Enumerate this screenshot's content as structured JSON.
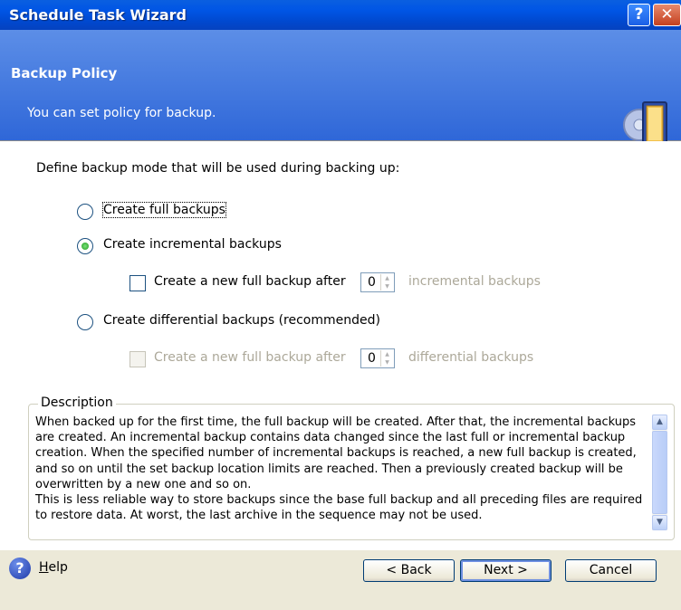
{
  "window": {
    "title": "Schedule Task Wizard",
    "help_glyph": "?",
    "close_glyph": "✕"
  },
  "header": {
    "title": "Backup Policy",
    "subtitle": "You can set policy for backup.",
    "icon": "wizard-book-icon"
  },
  "main": {
    "define_label": "Define backup mode that will be used during backing up:",
    "options": {
      "full": {
        "label": "Create full backups",
        "selected": false
      },
      "incremental": {
        "label": "Create incremental backups",
        "selected": true,
        "sub_check_label": "Create a new full backup after",
        "sub_value": "0",
        "sub_suffix": "incremental backups"
      },
      "differential": {
        "label": "Create differential backups (recommended)",
        "selected": false,
        "sub_check_label": "Create a new full backup after",
        "sub_value": "0",
        "sub_suffix": "differential backups"
      }
    },
    "description": {
      "legend": "Description",
      "text": "When backed up for the first time, the full backup will be created. After that, the incremental backups are created. An incremental backup contains data changed since the last full or incremental backup creation. When the specified number of incremental backups is reached, a new full backup is created, and so on until the set backup location limits are reached. Then a previously created backup will be overwritten by a new one and so on.\nThis is less reliable way to store backups since the base full backup and all preceding files are required to restore data. At worst, the last archive in the sequence may not be used."
    }
  },
  "footer": {
    "help_label": "Help",
    "back_label": "< Back",
    "next_label": "Next >",
    "cancel_label": "Cancel"
  },
  "colors": {
    "title_bar": "#0054e3",
    "header_blue": "#3b74dd",
    "dialog_bg": "#ece9d8",
    "radio_checked": "#1f9d1f"
  }
}
